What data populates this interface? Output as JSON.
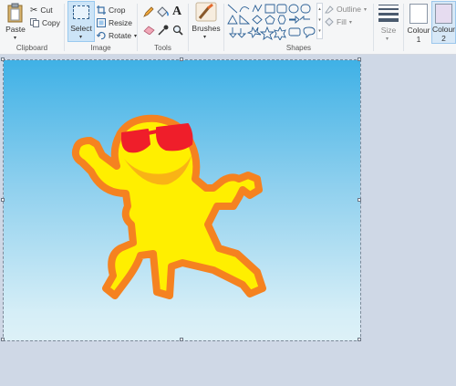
{
  "clipboard": {
    "group_label": "Clipboard",
    "paste": "Paste",
    "cut": "Cut",
    "copy": "Copy"
  },
  "image": {
    "group_label": "Image",
    "select": "Select",
    "crop": "Crop",
    "resize": "Resize",
    "rotate": "Rotate"
  },
  "tools": {
    "group_label": "Tools"
  },
  "brushes": {
    "label": "Brushes"
  },
  "shapes": {
    "group_label": "Shapes",
    "outline": "Outline",
    "fill": "Fill"
  },
  "size": {
    "label": "Size"
  },
  "colours": {
    "colour1": "Colour",
    "colour1_num": "1",
    "colour2": "Colour",
    "colour2_num": "2"
  },
  "colors": {
    "sky_top": "#3fb1e6",
    "sky_bottom": "#ddf1f7",
    "figure_fill": "#ffef00",
    "figure_outline": "#f58220",
    "glasses": "#ef1e2a",
    "colour2_swatch": "#e6dcf0"
  }
}
